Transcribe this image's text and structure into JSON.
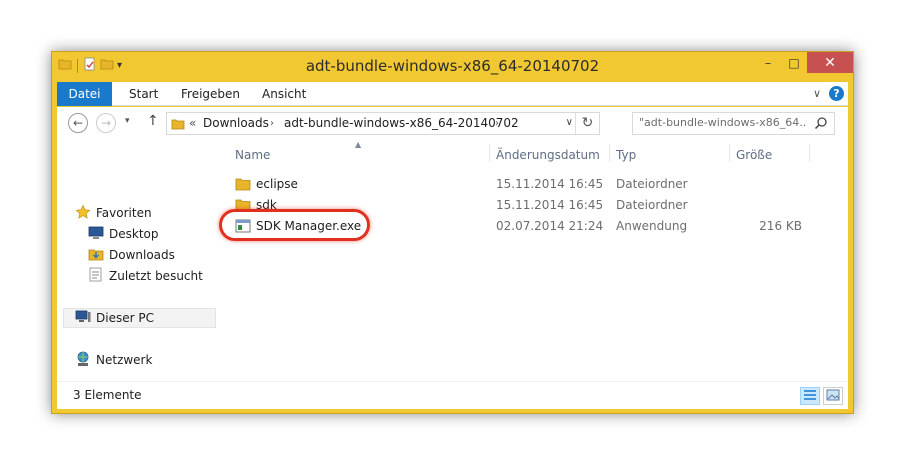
{
  "window": {
    "title": "adt-bundle-windows-x86_64-20140702"
  },
  "window_controls": {
    "minimize": "–",
    "maximize": "□",
    "close": "✕"
  },
  "ribbon": {
    "tabs": [
      {
        "label": "Datei",
        "active": true
      },
      {
        "label": "Start"
      },
      {
        "label": "Freigeben"
      },
      {
        "label": "Ansicht"
      }
    ],
    "expand_glyph": "∨",
    "help_glyph": "?"
  },
  "address": {
    "back_glyph": "←",
    "forward_glyph": "→",
    "history_glyph": "▾",
    "up_glyph": "↑",
    "overflow": "«",
    "crumbs": [
      "Downloads",
      "adt-bundle-windows-x86_64-20140702"
    ],
    "crumb_sep": "›",
    "dropdown_glyph": "∨",
    "refresh_glyph": "↻"
  },
  "search": {
    "placeholder": "\"adt-bundle-windows-x86_64..."
  },
  "nav": {
    "favorites": "Favoriten",
    "desktop": "Desktop",
    "downloads": "Downloads",
    "recent": "Zuletzt besucht",
    "this_pc": "Dieser PC",
    "network": "Netzwerk"
  },
  "columns": {
    "name": "Name",
    "date": "Änderungsdatum",
    "type": "Typ",
    "size": "Größe"
  },
  "files": [
    {
      "name": "eclipse",
      "date": "15.11.2014 16:45",
      "type": "Dateiordner",
      "size": "",
      "icon": "folder-icon"
    },
    {
      "name": "sdk",
      "date": "15.11.2014 16:45",
      "type": "Dateiordner",
      "size": "",
      "icon": "folder-icon"
    },
    {
      "name": "SDK Manager.exe",
      "date": "02.07.2014 21:24",
      "type": "Anwendung",
      "size": "216 KB",
      "icon": "exe-icon"
    }
  ],
  "status": {
    "count": "3 Elemente"
  },
  "colors": {
    "frame": "#f2c832",
    "accent": "#1979ca",
    "highlight": "#e0301e",
    "folder": "#e8b42a"
  }
}
